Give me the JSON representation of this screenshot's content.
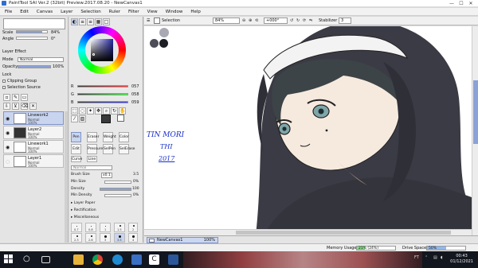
{
  "window": {
    "title": "PaintTool SAI Ver.2 (32bit) Preview.2017.08.20 - NewCanvas1",
    "buttons": [
      "—",
      "☐",
      "✕"
    ]
  },
  "menu": [
    "File",
    "Edit",
    "Canvas",
    "Layer",
    "Selection",
    "Ruler",
    "Filter",
    "View",
    "Window",
    "Help"
  ],
  "left_panel": {
    "scale_label": "Scale",
    "scale_value": "84%",
    "angle_label": "Angle",
    "angle_value": "0°",
    "layer_effect_label": "Layer Effect",
    "mode_label": "Mode",
    "mode_value": "Normal",
    "opacity_label": "Opacity",
    "opacity_value": "100%",
    "lock_label": "Lock",
    "clipping_group": "Clipping Group",
    "selection_source": "Selection Source",
    "layers": [
      {
        "name": "Linework2",
        "mode": "Normal",
        "opacity": "100%"
      },
      {
        "name": "Layer2",
        "mode": "Normal",
        "opacity": "100%"
      },
      {
        "name": "Linework1",
        "mode": "Normal",
        "opacity": "100%"
      },
      {
        "name": "Layer1",
        "mode": "Normal",
        "opacity": "100%"
      }
    ]
  },
  "color_panel": {
    "sliders": [
      {
        "label": "R",
        "value": "057"
      },
      {
        "label": "G",
        "value": "058"
      },
      {
        "label": "B",
        "value": "059"
      }
    ]
  },
  "tools": {
    "row1": [
      "Pen",
      "Eraser",
      "Weight",
      "Color"
    ],
    "row2": [
      "Edit",
      "Pressure",
      "SelPen",
      "SelErase"
    ],
    "row3": [
      "Curve",
      "Line"
    ],
    "blend_mode": "Normal",
    "brush_size_label": "Brush Size",
    "brush_size_mult": "x0.1",
    "brush_size_value": "3.5",
    "min_size_label": "Min Size",
    "min_size_value": "0%",
    "density_label": "Density",
    "density_value": "100",
    "min_density_label": "Min Density",
    "min_density_value": "0%",
    "sections": [
      "Layer Paper",
      "Rectification",
      "Miscellaneous"
    ],
    "sizes_row1": [
      "0.7",
      "0.8",
      "1",
      "1.5",
      "2"
    ],
    "sizes_row2": [
      "2.3",
      "2.6",
      "3",
      "3.5",
      "4"
    ],
    "sizes_row3": [
      "5",
      "6",
      "7",
      "8",
      "9"
    ]
  },
  "canvas_bar": {
    "selection_label": "Selection",
    "zoom": "84%",
    "angle": "+000°",
    "stabilizer_label": "Stabilizer",
    "stabilizer_value": "3"
  },
  "canvas": {
    "handwriting": [
      "TIN MORI",
      "THI",
      "2017"
    ],
    "ink_color": "#1a2ec8",
    "swatch_colors": [
      "#a9a9b4",
      "#4d4d58",
      "#1e1e26"
    ]
  },
  "navigator": {
    "canvas_name": "NewCanvas1",
    "zoom": "100%"
  },
  "status": {
    "memory_label": "Memory Usage",
    "memory_value": "21% (24%)",
    "memory_fraction": 0.21,
    "drive_label": "Drive Space",
    "drive_value": "50%",
    "drive_fraction": 0.5
  },
  "taskbar": {
    "tray_text": "FT",
    "time": "00:43",
    "date": "01/12/2021",
    "icons": [
      "start",
      "search",
      "task-view",
      "file-explorer",
      "chrome",
      "edge",
      "store",
      "app-c",
      "word",
      "sai"
    ]
  }
}
